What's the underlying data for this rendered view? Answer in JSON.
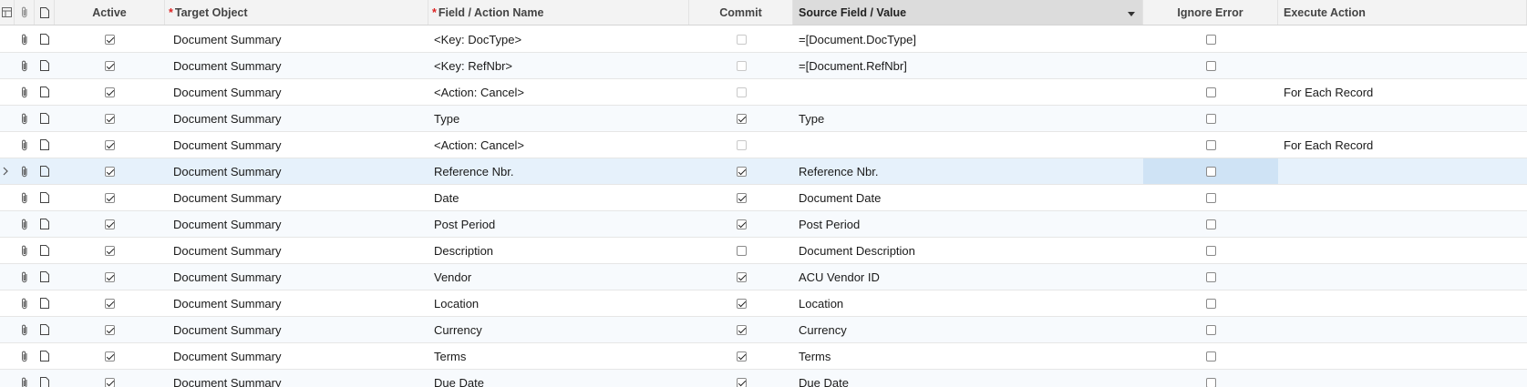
{
  "columns": {
    "active": "Active",
    "target_object": "Target Object",
    "field_action": "Field / Action Name",
    "commit": "Commit",
    "source_field": "Source Field / Value",
    "ignore_error": "Ignore Error",
    "execute_action": "Execute Action"
  },
  "rows": [
    {
      "active": true,
      "target_object": "Document Summary",
      "field_action": "<Key: DocType>",
      "commit": false,
      "commit_disabled": true,
      "source": "=[Document.DocType]",
      "ignore_error": false,
      "execute": ""
    },
    {
      "active": true,
      "target_object": "Document Summary",
      "field_action": "<Key: RefNbr>",
      "commit": false,
      "commit_disabled": true,
      "source": "=[Document.RefNbr]",
      "ignore_error": false,
      "execute": ""
    },
    {
      "active": true,
      "target_object": "Document Summary",
      "field_action": "<Action: Cancel>",
      "commit": false,
      "commit_disabled": true,
      "source": "",
      "ignore_error": false,
      "execute": "For Each Record"
    },
    {
      "active": true,
      "target_object": "Document Summary",
      "field_action": "Type",
      "commit": true,
      "commit_disabled": false,
      "source": "Type",
      "ignore_error": false,
      "execute": ""
    },
    {
      "active": true,
      "target_object": "Document Summary",
      "field_action": "<Action: Cancel>",
      "commit": false,
      "commit_disabled": true,
      "source": "",
      "ignore_error": false,
      "execute": "For Each Record"
    },
    {
      "active": true,
      "target_object": "Document Summary",
      "field_action": "Reference Nbr.",
      "commit": true,
      "commit_disabled": false,
      "source": "Reference Nbr.",
      "ignore_error": false,
      "execute": "",
      "selected": true
    },
    {
      "active": true,
      "target_object": "Document Summary",
      "field_action": "Date",
      "commit": true,
      "commit_disabled": false,
      "source": "Document Date",
      "ignore_error": false,
      "execute": ""
    },
    {
      "active": true,
      "target_object": "Document Summary",
      "field_action": "Post Period",
      "commit": true,
      "commit_disabled": false,
      "source": "Post Period",
      "ignore_error": false,
      "execute": ""
    },
    {
      "active": true,
      "target_object": "Document Summary",
      "field_action": "Description",
      "commit": false,
      "commit_disabled": false,
      "source": "Document Description",
      "ignore_error": false,
      "execute": ""
    },
    {
      "active": true,
      "target_object": "Document Summary",
      "field_action": "Vendor",
      "commit": true,
      "commit_disabled": false,
      "source": "ACU Vendor ID",
      "ignore_error": false,
      "execute": ""
    },
    {
      "active": true,
      "target_object": "Document Summary",
      "field_action": "Location",
      "commit": true,
      "commit_disabled": false,
      "source": "Location",
      "ignore_error": false,
      "execute": ""
    },
    {
      "active": true,
      "target_object": "Document Summary",
      "field_action": "Currency",
      "commit": true,
      "commit_disabled": false,
      "source": "Currency",
      "ignore_error": false,
      "execute": ""
    },
    {
      "active": true,
      "target_object": "Document Summary",
      "field_action": "Terms",
      "commit": true,
      "commit_disabled": false,
      "source": "Terms",
      "ignore_error": false,
      "execute": ""
    },
    {
      "active": true,
      "target_object": "Document Summary",
      "field_action": "Due Date",
      "commit": true,
      "commit_disabled": false,
      "source": "Due Date",
      "ignore_error": false,
      "execute": ""
    }
  ]
}
